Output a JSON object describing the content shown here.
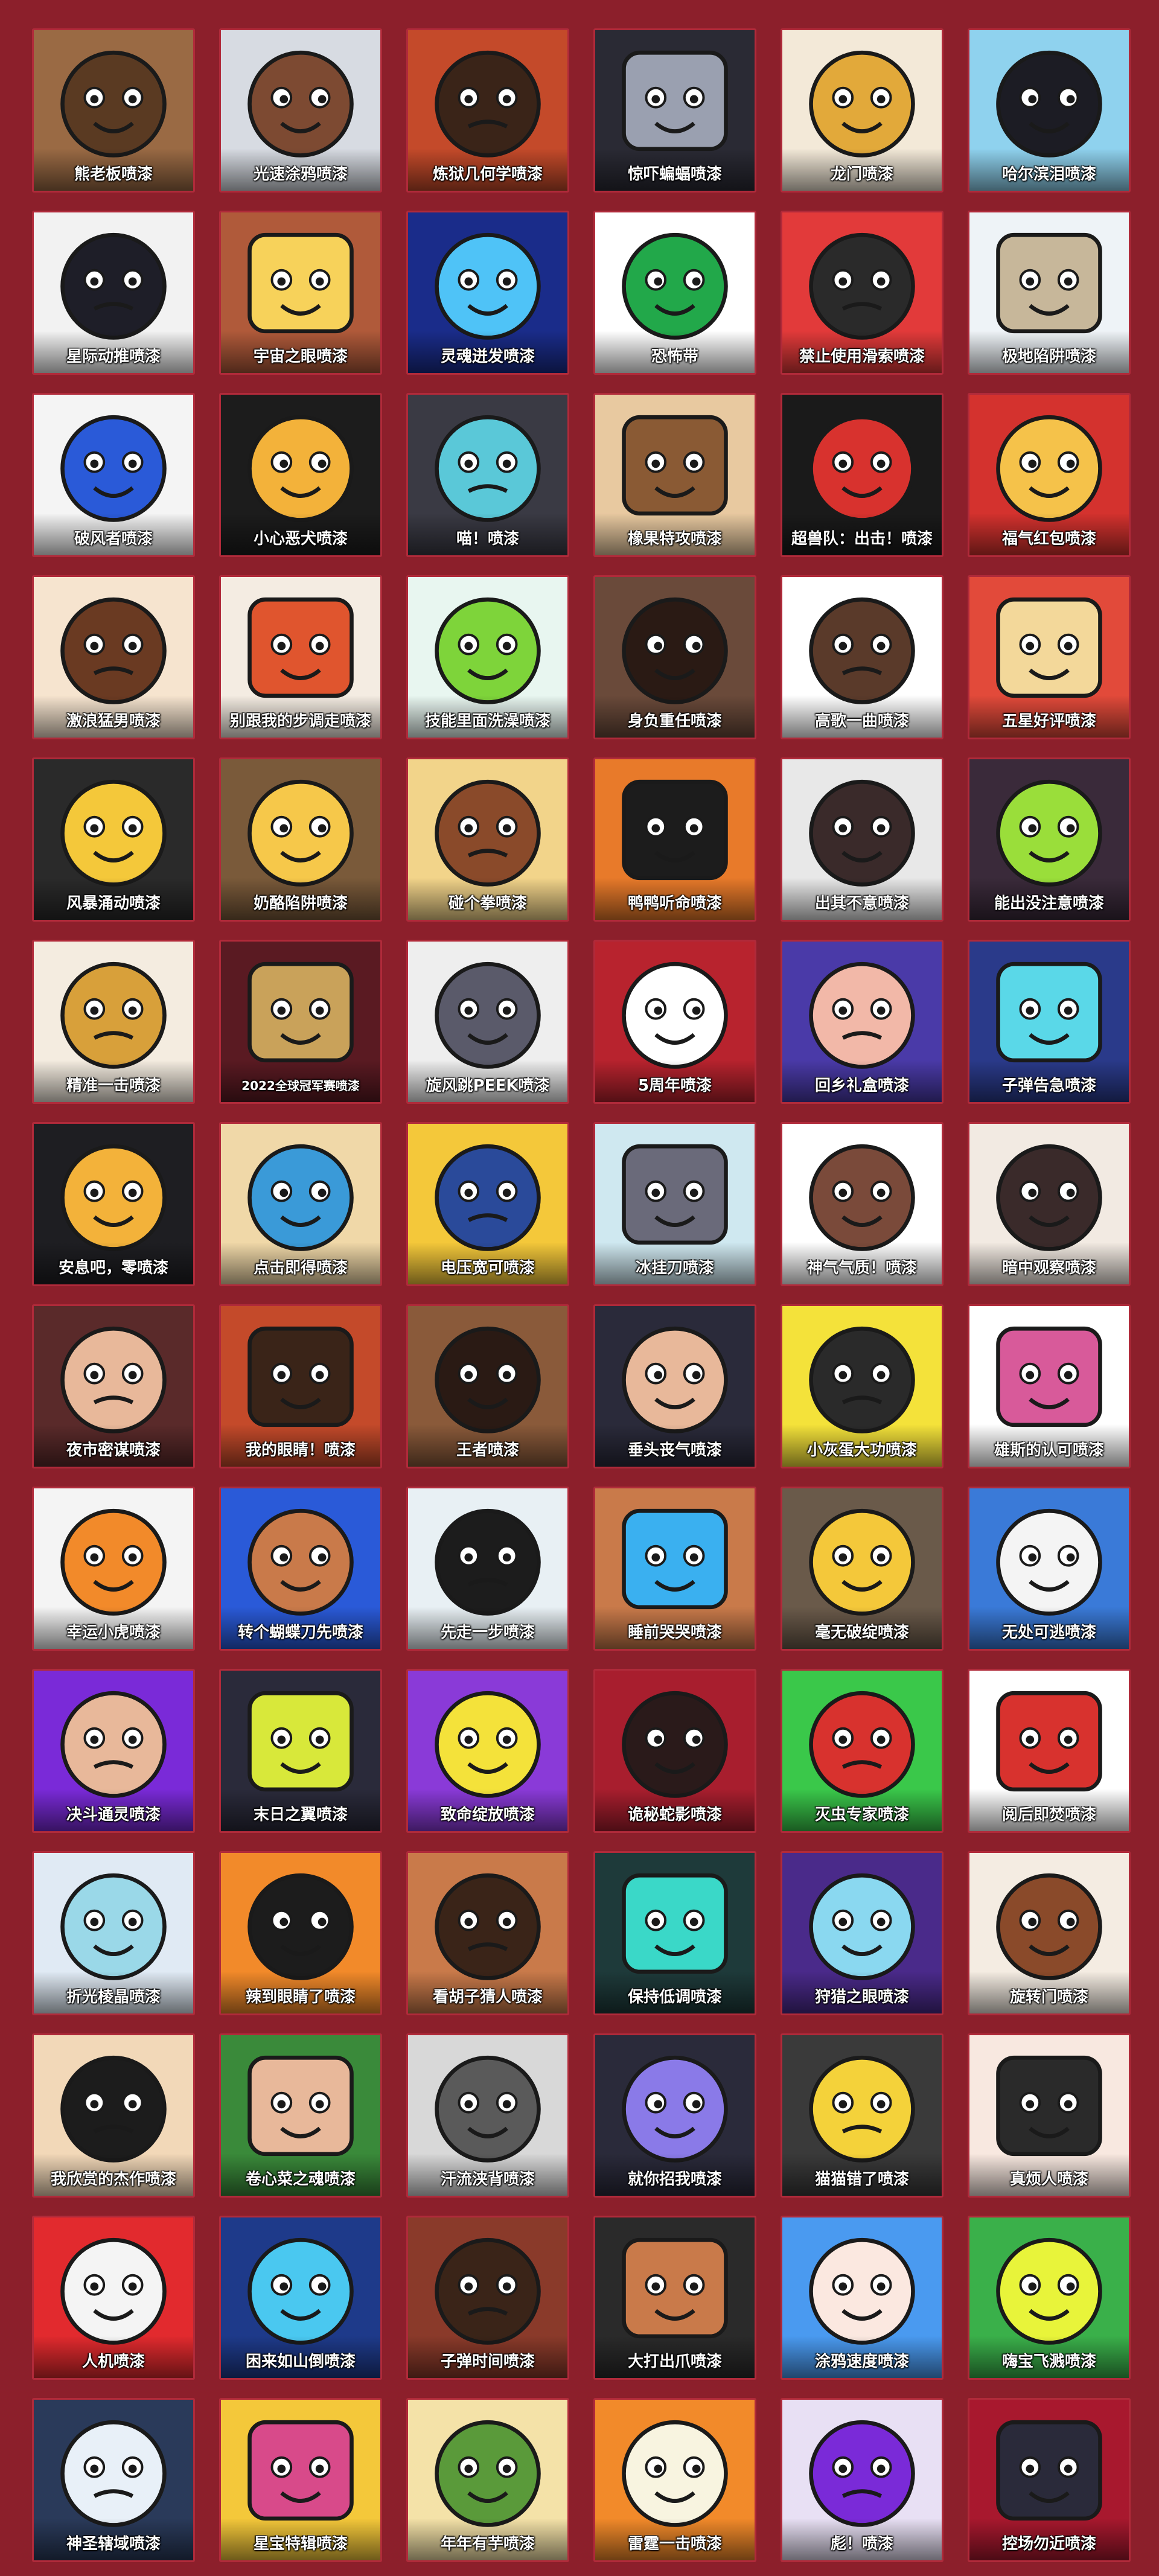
{
  "page": {
    "background": "#8c1f2b",
    "tile_border": "#b02a3a"
  },
  "sprays": [
    {
      "name": "熊老板喷漆",
      "icon": "bear-sunglasses",
      "bg": "#9a6a44",
      "fg": "#5a3a22"
    },
    {
      "name": "光速涂鸦喷漆",
      "icon": "grumpy-man",
      "bg": "#d7dbe2",
      "fg": "#7d4a32"
    },
    {
      "name": "炼狱几何学喷漆",
      "icon": "bandana-gunner",
      "bg": "#c44a2a",
      "fg": "#3a2418"
    },
    {
      "name": "惊吓蝙蝠喷漆",
      "icon": "bat-mask",
      "bg": "#2a2a34",
      "fg": "#9aa0b0"
    },
    {
      "name": "龙门喷漆",
      "icon": "golden-dragon",
      "bg": "#f3e9d8",
      "fg": "#e2a93a"
    },
    {
      "name": "哈尔滨泪喷漆",
      "icon": "crying-penguin",
      "bg": "#8fd2ee",
      "fg": "#1c1c24"
    },
    {
      "name": "星际动推喷漆",
      "icon": "pointing-girl",
      "bg": "#f2f2f2",
      "fg": "#1e1e28"
    },
    {
      "name": "宇宙之眼喷漆",
      "icon": "starry-eyes",
      "bg": "#b05a3a",
      "fg": "#f7d25a"
    },
    {
      "name": "灵魂迸发喷漆",
      "icon": "blue-crystal",
      "bg": "#1a2c8a",
      "fg": "#4fc3f7"
    },
    {
      "name": "恐怖带",
      "icon": "green-runner",
      "bg": "#ffffff",
      "fg": "#22a84a"
    },
    {
      "name": "禁止使用滑索喷漆",
      "icon": "zipline-silhouette",
      "bg": "#e23a3a",
      "fg": "#2a2a2a"
    },
    {
      "name": "极地陷阱喷漆",
      "icon": "blonde-agent",
      "bg": "#eef3f7",
      "fg": "#c7b79a"
    },
    {
      "name": "破风者喷漆",
      "icon": "blue-ninja",
      "bg": "#f4f4f4",
      "fg": "#2a5ad8"
    },
    {
      "name": "小心恶犬喷漆",
      "icon": "wolf-mask",
      "bg": "#1c1c1c",
      "fg": "#f3b23a"
    },
    {
      "name": "喵！喷漆",
      "icon": "robot-helmet",
      "bg": "#3a3a44",
      "fg": "#5ac8d8"
    },
    {
      "name": "橡果特攻喷漆",
      "icon": "squirrel-face",
      "bg": "#e8c9a0",
      "fg": "#8a5a34"
    },
    {
      "name": "超兽队：出击！喷漆",
      "icon": "red-helmet",
      "bg": "#1a1a1a",
      "fg": "#d8322e"
    },
    {
      "name": "福气红包喷漆",
      "icon": "golden-horse",
      "bg": "#d4322e",
      "fg": "#f5c24a"
    },
    {
      "name": "激浪猛男喷漆",
      "icon": "muscle-arm",
      "bg": "#f6e4cf",
      "fg": "#6a3a22"
    },
    {
      "name": "别跟我的步调走喷漆",
      "icon": "cheering-woman",
      "bg": "#f4ece2",
      "fg": "#e0552e"
    },
    {
      "name": "技能里面洗澡喷漆",
      "icon": "green-slime",
      "bg": "#e8f6f0",
      "fg": "#7ed43a"
    },
    {
      "name": "身负重任喷漆",
      "icon": "dreadlocks",
      "bg": "#6a4a3a",
      "fg": "#2a1a14"
    },
    {
      "name": "高歌一曲喷漆",
      "icon": "headphones-singer",
      "bg": "#ffffff",
      "fg": "#5a3a2a"
    },
    {
      "name": "五星好评喷漆",
      "icon": "bear-penguin",
      "bg": "#e24a3a",
      "fg": "#f3d89a"
    },
    {
      "name": "风暴涌动喷漆",
      "icon": "dark-storm",
      "bg": "#2a2a2a",
      "fg": "#f4c83a"
    },
    {
      "name": "奶酪陷阱喷漆",
      "icon": "cheese-block",
      "bg": "#7a5a3a",
      "fg": "#f6c84a"
    },
    {
      "name": "碰个拳喷漆",
      "icon": "fist-bump",
      "bg": "#f2d48a",
      "fg": "#8a4a2a"
    },
    {
      "name": "鸭鸭听命喷漆",
      "icon": "duck-sunglasses",
      "bg": "#e87a2a",
      "fg": "#1c1c1c"
    },
    {
      "name": "出其不意喷漆",
      "icon": "masked-agent",
      "bg": "#e8e8e8",
      "fg": "#3a2a2a"
    },
    {
      "name": "能出没注意喷漆",
      "icon": "hex-pattern",
      "bg": "#3a2a3a",
      "fg": "#9ade3a"
    },
    {
      "name": "精准一击喷漆",
      "icon": "bullet-impact",
      "bg": "#f4ece0",
      "fg": "#d8a03a"
    },
    {
      "name": "2022全球冠军赛喷漆",
      "icon": "champions-emblem",
      "bg": "#5a1a22",
      "fg": "#c9a25a"
    },
    {
      "name": "旋风跳PEEK喷漆",
      "icon": "silver-hair-girl",
      "bg": "#eeeeee",
      "fg": "#5a5a6a"
    },
    {
      "name": "5周年喷漆",
      "icon": "birthday-candle",
      "bg": "#b8232e",
      "fg": "#ffffff"
    },
    {
      "name": "回乡礼盒喷漆",
      "icon": "blue-hair-girl",
      "bg": "#4a3aa8",
      "fg": "#f2b8a8"
    },
    {
      "name": "子弹告急喷漆",
      "icon": "hooded-ghost",
      "bg": "#2a3a8a",
      "fg": "#5ad8e8"
    },
    {
      "name": "安息吧，零喷漆",
      "icon": "dark-helmet",
      "bg": "#1e1e22",
      "fg": "#f3b23a"
    },
    {
      "name": "点击即得喷漆",
      "icon": "blue-line-face",
      "bg": "#f0d8a8",
      "fg": "#3a9ad8"
    },
    {
      "name": "电压宽可喷漆",
      "icon": "blue-suit-dancer",
      "bg": "#f4c83a",
      "fg": "#2a4a9a"
    },
    {
      "name": "冰挂刀喷漆",
      "icon": "white-hair-grin",
      "bg": "#cfe8f0",
      "fg": "#6a6a7a"
    },
    {
      "name": "神气气质！喷漆",
      "icon": "smiling-woman",
      "bg": "#ffffff",
      "fg": "#7a4a3a"
    },
    {
      "name": "暗中观察喷漆",
      "icon": "smirk-face",
      "bg": "#f2eae2",
      "fg": "#3a2a2a"
    },
    {
      "name": "夜市密谋喷漆",
      "icon": "shocked-woman",
      "bg": "#5a2a2a",
      "fg": "#e8b89a"
    },
    {
      "name": "我的眼睛！喷漆",
      "icon": "crying-bandana",
      "bg": "#c44a2a",
      "fg": "#3a2418"
    },
    {
      "name": "王者喷漆",
      "icon": "bearded-man",
      "bg": "#8a5a3a",
      "fg": "#2a1a14"
    },
    {
      "name": "垂头丧气喷漆",
      "icon": "sad-dark-hair",
      "bg": "#2a2a3a",
      "fg": "#e8b89a"
    },
    {
      "name": "小灰蛋大功喷漆",
      "icon": "yellow-creature",
      "bg": "#f4e23a",
      "fg": "#2a2a2a"
    },
    {
      "name": "雄斯的认可喷漆",
      "icon": "hand-cake",
      "bg": "#ffffff",
      "fg": "#d85a9a"
    },
    {
      "name": "幸运小虎喷漆",
      "icon": "tiger-cub",
      "bg": "#f4f4f4",
      "fg": "#f28a2a"
    },
    {
      "name": "转个蝴蝶刀先喷漆",
      "icon": "blue-hair-woman",
      "bg": "#2a5ad8",
      "fg": "#c97a4a"
    },
    {
      "name": "先走一步喷漆",
      "icon": "googly-eyes",
      "bg": "#e8f0f4",
      "fg": "#1c1c1c"
    },
    {
      "name": "睡前哭哭喷漆",
      "icon": "crying-face",
      "bg": "#c97a4a",
      "fg": "#3ab0f0"
    },
    {
      "name": "毫无破绽喷漆",
      "icon": "bird-mask",
      "bg": "#6a5a4a",
      "fg": "#f4c83a"
    },
    {
      "name": "无处可逃喷漆",
      "icon": "surprised-face",
      "bg": "#3a7ad8",
      "fg": "#f4f4f4"
    },
    {
      "name": "决斗通灵喷漆",
      "icon": "purple-glare",
      "bg": "#7a2ad8",
      "fg": "#e8b89a"
    },
    {
      "name": "末日之翼喷漆",
      "icon": "dark-visor",
      "bg": "#2a2a3a",
      "fg": "#d8e83a"
    },
    {
      "name": "致命绽放喷漆",
      "icon": "spiky-orb",
      "bg": "#8a3ad8",
      "fg": "#f4e23a"
    },
    {
      "name": "诡秘蛇影喷漆",
      "icon": "red-serpent",
      "bg": "#a81e2e",
      "fg": "#2a1a1a"
    },
    {
      "name": "灭虫专家喷漆",
      "icon": "no-bug-sign",
      "bg": "#3ac84a",
      "fg": "#d8322e"
    },
    {
      "name": "阅后即焚喷漆",
      "icon": "forbidden-lantern",
      "bg": "#ffffff",
      "fg": "#d8322e"
    },
    {
      "name": "折光棱晶喷漆",
      "icon": "prism",
      "bg": "#e0eaf4",
      "fg": "#9ad8e8"
    },
    {
      "name": "辣到眼睛了喷漆",
      "icon": "orange-creature",
      "bg": "#f28a2a",
      "fg": "#1c1c1c"
    },
    {
      "name": "看胡子猜人喷漆",
      "icon": "mustache",
      "bg": "#c97a4a",
      "fg": "#3a2418"
    },
    {
      "name": "保持低调喷漆",
      "icon": "teal-visor",
      "bg": "#1e3a3a",
      "fg": "#3ad8c8"
    },
    {
      "name": "狩猎之眼喷漆",
      "icon": "purple-eye",
      "bg": "#4a2a8a",
      "fg": "#8ad8f0"
    },
    {
      "name": "旋转门喷漆",
      "icon": "curly-hair-man",
      "bg": "#f4ece2",
      "fg": "#8a4a2a"
    },
    {
      "name": "我欣赏的杰作喷漆",
      "icon": "glasses-smile",
      "bg": "#f2d8b8",
      "fg": "#1c1c1c"
    },
    {
      "name": "卷心菜之魂喷漆",
      "icon": "green-headband",
      "bg": "#3a8a3a",
      "fg": "#e8b89a"
    },
    {
      "name": "汗流浃背喷漆",
      "icon": "seal-face",
      "bg": "#d8d8d8",
      "fg": "#5a5a5a"
    },
    {
      "name": "就你招我喷漆",
      "icon": "purple-eyes-boy",
      "bg": "#2a2a3a",
      "fg": "#8a7ae8"
    },
    {
      "name": "猫猫错了喷漆",
      "icon": "black-cat",
      "bg": "#3a3a3a",
      "fg": "#f4d23a"
    },
    {
      "name": "真烦人喷漆",
      "icon": "annoyed-face",
      "bg": "#f8e8e0",
      "fg": "#2a2a2a"
    },
    {
      "name": "人机喷漆",
      "icon": "rockets",
      "bg": "#e22a2e",
      "fg": "#f4f4f4"
    },
    {
      "name": "困来如山倒喷漆",
      "icon": "sleepy-robot",
      "bg": "#1e3a8a",
      "fg": "#4ac8f0"
    },
    {
      "name": "子弹时间喷漆",
      "icon": "scar-face",
      "bg": "#8a3a2a",
      "fg": "#3a2418"
    },
    {
      "name": "大打出爪喷漆",
      "icon": "angry-raccoon",
      "bg": "#2a2a2a",
      "fg": "#c97a4a"
    },
    {
      "name": "涂鸦速度喷漆",
      "icon": "pale-face",
      "bg": "#4a9af0",
      "fg": "#fbe8e0"
    },
    {
      "name": "嗨宝飞溅喷漆",
      "icon": "green-splash",
      "bg": "#3ab04a",
      "fg": "#e8f43a"
    },
    {
      "name": "神圣辖域喷漆",
      "icon": "orbit-symbol",
      "bg": "#2a3a5a",
      "fg": "#e8f0f8"
    },
    {
      "name": "星宝特辑喷漆",
      "icon": "sunburst",
      "bg": "#f4c83a",
      "fg": "#d84a8a"
    },
    {
      "name": "年年有芋喷漆",
      "icon": "taro",
      "bg": "#f4e2a8",
      "fg": "#5a9a3a"
    },
    {
      "name": "雷霆一击喷漆",
      "icon": "orange-blast",
      "bg": "#f28a2a",
      "fg": "#f8f4e0"
    },
    {
      "name": "彪！喷漆",
      "icon": "purple-swirl",
      "bg": "#e8e0f4",
      "fg": "#7a2ad8"
    },
    {
      "name": "控场勿近喷漆",
      "icon": "red-chevron",
      "bg": "#a8182e",
      "fg": "#2a2a3a"
    }
  ]
}
